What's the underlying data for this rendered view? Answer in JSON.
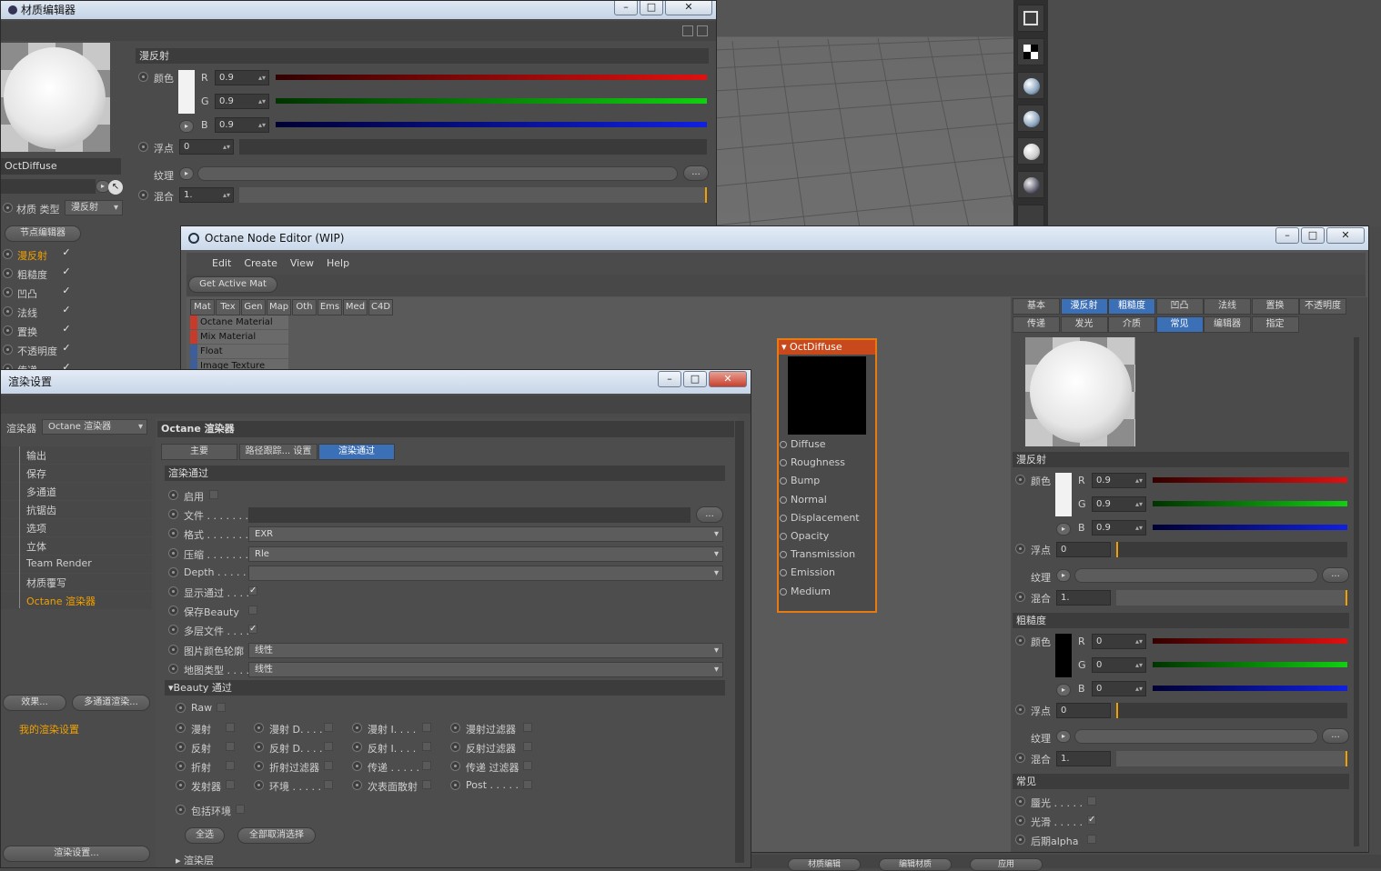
{
  "mat_editor": {
    "title": "材质编辑器",
    "mat_name": "OctDiffuse",
    "mat_type_label": "材质 类型",
    "mat_type_value": "漫反射",
    "node_editor_btn": "节点编辑器",
    "channels": [
      {
        "label": "漫反射",
        "checked": true,
        "active": true
      },
      {
        "label": "粗糙度",
        "checked": true
      },
      {
        "label": "凹凸",
        "checked": true
      },
      {
        "label": "法线",
        "checked": true
      },
      {
        "label": "置换",
        "checked": true
      },
      {
        "label": "不透明度",
        "checked": true
      },
      {
        "label": "传递",
        "checked": true
      }
    ],
    "section": "漫反射",
    "color_label": "颜色",
    "r_label": "R",
    "g_label": "G",
    "b_label": "B",
    "r": "0.9",
    "g": "0.9",
    "b": "0.9",
    "float_label": "浮点",
    "float_value": "0",
    "texture_label": "纹理",
    "texture_btn": "...",
    "mix_label": "混合",
    "mix_value": "1."
  },
  "node_editor": {
    "title": "Octane Node Editor (WIP)",
    "menu": [
      "Edit",
      "Create",
      "View",
      "Help"
    ],
    "get_active_mat": "Get Active Mat",
    "cat_tabs": [
      "Mat",
      "Tex",
      "Gen",
      "Map",
      "Oth",
      "Ems",
      "Med",
      "C4D"
    ],
    "node_list": [
      {
        "label": "Octane Material",
        "color": "#c83a2a"
      },
      {
        "label": "Mix Material",
        "color": "#c83a2a"
      },
      {
        "label": "Float",
        "color": "#3c5f9c"
      },
      {
        "label": "Image Texture",
        "color": "#3c5f9c"
      }
    ],
    "node": {
      "title": "OctDiffuse",
      "pins": [
        "Diffuse",
        "Roughness",
        "Bump",
        "Normal",
        "Displacement",
        "Opacity",
        "Transmission",
        "Emission",
        "Medium"
      ]
    },
    "attr_tabs_row1": [
      {
        "label": "基本",
        "active": false
      },
      {
        "label": "漫反射",
        "active": true
      },
      {
        "label": "粗糙度",
        "active": true
      },
      {
        "label": "凹凸",
        "active": false
      },
      {
        "label": "法线",
        "active": false
      },
      {
        "label": "置换",
        "active": false
      },
      {
        "label": "不透明度",
        "active": false
      }
    ],
    "attr_tabs_row2": [
      {
        "label": "传递",
        "active": false
      },
      {
        "label": "发光",
        "active": false
      },
      {
        "label": "介质",
        "active": false
      },
      {
        "label": "常见",
        "active": true
      },
      {
        "label": "编辑器",
        "active": false
      },
      {
        "label": "指定",
        "active": false
      }
    ],
    "diffuse_section": "漫反射",
    "rough_section": "粗糙度",
    "common_section": "常见",
    "color_label": "颜色",
    "float_label": "浮点",
    "texture_label": "纹理",
    "mix_label": "混合",
    "r_label": "R",
    "g_label": "G",
    "b_label": "B",
    "diffuse": {
      "r": "0.9",
      "g": "0.9",
      "b": "0.9",
      "float": "0",
      "mix": "1."
    },
    "rough": {
      "r": "0",
      "g": "0",
      "b": "0",
      "float": "0",
      "mix": "1."
    },
    "texture_btn": "...",
    "common_items": [
      {
        "label": "蜃光 . . . . .",
        "checked": false
      },
      {
        "label": "光滑 . . . . .",
        "checked": true
      },
      {
        "label": "后期alpha",
        "checked": false
      }
    ]
  },
  "render_settings": {
    "title": "渲染设置",
    "renderer_label": "渲染器",
    "renderer_value": "Octane 渲染器",
    "tree": [
      "输出",
      "保存",
      "多通道",
      "抗锯齿",
      "选项",
      "立体",
      "Team Render",
      "材质覆写",
      "Octane 渲染器"
    ],
    "effects_btn": "效果...",
    "multipass_btn": "多通道渲染...",
    "my_settings": "我的渲染设置",
    "render_settings_btn": "渲染设置...",
    "panel_title": "Octane 渲染器",
    "tabs": [
      {
        "label": "主要",
        "active": false
      },
      {
        "label": "路径跟踪... 设置",
        "active": false
      },
      {
        "label": "渲染通过",
        "active": true
      }
    ],
    "section": "渲染通过",
    "rows": [
      {
        "label": "启用",
        "type": "check",
        "checked": false
      },
      {
        "label": "文件 . . . . . . .",
        "type": "file",
        "btn": "..."
      },
      {
        "label": "格式 . . . . . . .",
        "type": "dd",
        "value": "EXR"
      },
      {
        "label": "压缩 . . . . . . .",
        "type": "dd",
        "value": "Rle"
      },
      {
        "label": "Depth . . . . . .",
        "type": "dd",
        "value": ""
      },
      {
        "label": "显示通过 . . . .",
        "type": "check",
        "checked": true
      },
      {
        "label": "保存Beauty",
        "type": "check",
        "checked": false
      },
      {
        "label": "多层文件 . . . .",
        "type": "check",
        "checked": true
      },
      {
        "label": "图片颜色轮廓",
        "type": "dd",
        "value": "线性"
      },
      {
        "label": "地图类型 . . . .",
        "type": "dd",
        "value": "线性"
      }
    ],
    "beauty_section": "Beauty 通过",
    "raw_label": "Raw",
    "beauty_grid": [
      [
        "漫射",
        "漫射 D. . . .",
        "漫射 I. . . .",
        "漫射过滤器"
      ],
      [
        "反射",
        "反射 D. . . .",
        "反射 I. . . .",
        "反射过滤器"
      ],
      [
        "折射",
        "折射过滤器",
        "传递 . . . . .",
        "传递 过滤器"
      ],
      [
        "发射器",
        "环境 . . . . .",
        "次表面散射",
        "Post . . . . ."
      ]
    ],
    "include_env": "包括环境",
    "select_all": "全选",
    "deselect_all": "全部取消选择",
    "render_layer": "渲染层"
  },
  "bottom_buttons": [
    "材质编辑",
    "编辑材质",
    "应用"
  ]
}
